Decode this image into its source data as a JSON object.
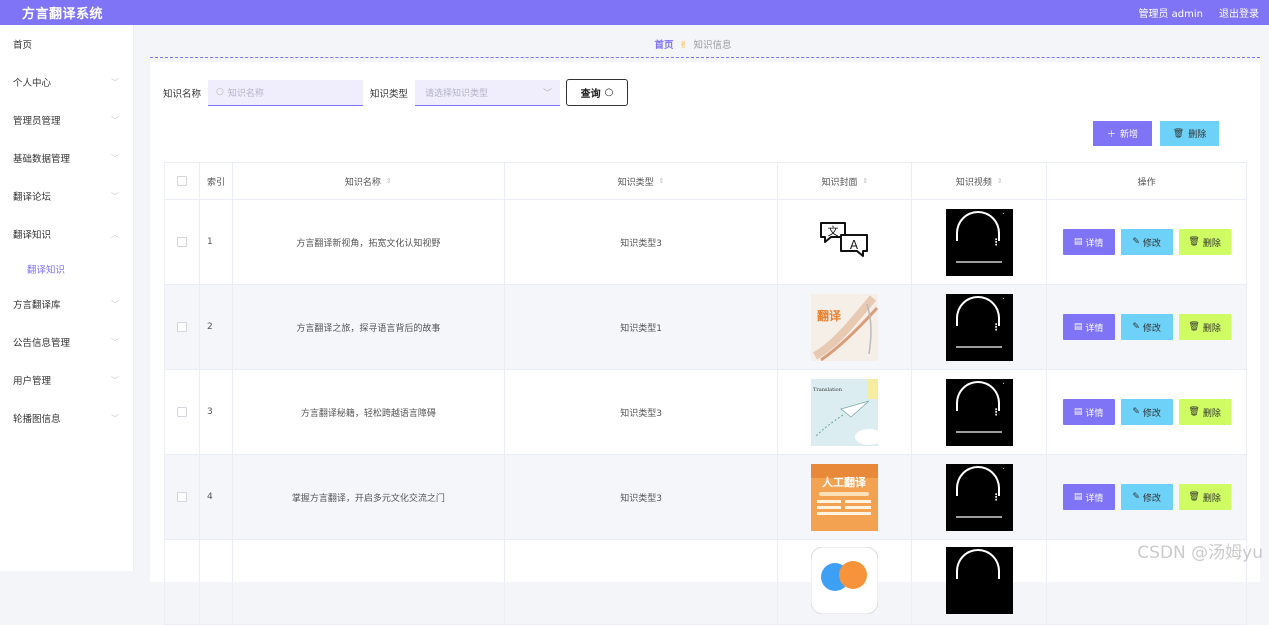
{
  "header": {
    "title": "方言翻译系统",
    "admin_label": "管理员 admin",
    "logout_label": "退出登录"
  },
  "sidebar": {
    "items": [
      {
        "label": "首页",
        "chevron": ""
      },
      {
        "label": "个人中心",
        "chevron": "﹀"
      },
      {
        "label": "管理员管理",
        "chevron": "﹀"
      },
      {
        "label": "基础数据管理",
        "chevron": "﹀"
      },
      {
        "label": "翻译论坛",
        "chevron": "﹀"
      },
      {
        "label": "翻译知识",
        "chevron": "︿"
      },
      {
        "label": "方言翻译库",
        "chevron": "﹀"
      },
      {
        "label": "公告信息管理",
        "chevron": "﹀"
      },
      {
        "label": "用户管理",
        "chevron": "﹀"
      },
      {
        "label": "轮播图信息",
        "chevron": "﹀"
      }
    ],
    "sub_item": "翻译知识"
  },
  "breadcrumb": {
    "home": "首页",
    "separator": "✌",
    "current": "知识信息"
  },
  "search": {
    "name_label": "知识名称",
    "name_placeholder": "知识名称",
    "type_label": "知识类型",
    "type_placeholder": "请选择知识类型",
    "query_label": "查询"
  },
  "actions": {
    "add_label": "新增",
    "delete_label": "删除"
  },
  "table": {
    "headers": {
      "index": "索引",
      "name": "知识名称",
      "type": "知识类型",
      "cover": "知识封面",
      "video": "知识视频",
      "ops": "操作"
    },
    "rows": [
      {
        "index": "1",
        "name": "方言翻译新视角，拓宽文化认知视野",
        "type": "知识类型3",
        "cover": "translate-icon"
      },
      {
        "index": "2",
        "name": "方言翻译之旅，探寻语言背后的故事",
        "type": "知识类型1",
        "cover": "ribbon-image"
      },
      {
        "index": "3",
        "name": "方言翻译秘籍，轻松跨越语言障碍",
        "type": "知识类型3",
        "cover": "paper-plane-image"
      },
      {
        "index": "4",
        "name": "掌握方言翻译，开启多元文化交流之门",
        "type": "知识类型3",
        "cover": "orange-banner-image"
      },
      {
        "index": "",
        "name": "",
        "type": "",
        "cover": "app-logo-image"
      }
    ],
    "op_labels": {
      "detail": "详情",
      "edit": "修改",
      "remove": "删除"
    }
  },
  "cover_texts": {
    "ribbon": "翻译",
    "plane": "Translation",
    "banner": "人工翻译"
  },
  "watermark": "CSDN @汤姆yu",
  "colors": {
    "accent": "#7f73f6",
    "info": "#6ed1f7",
    "lime": "#cffc62"
  }
}
